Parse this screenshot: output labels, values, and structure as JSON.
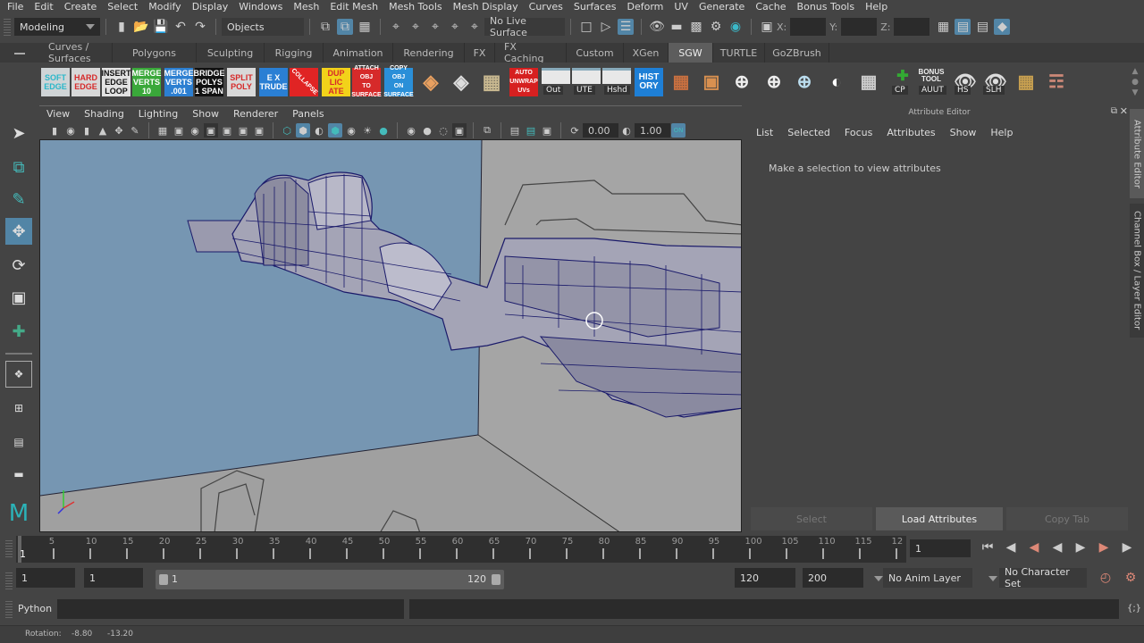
{
  "menubar": [
    "File",
    "Edit",
    "Create",
    "Select",
    "Modify",
    "Display",
    "Windows",
    "Mesh",
    "Edit Mesh",
    "Mesh Tools",
    "Mesh Display",
    "Curves",
    "Surfaces",
    "Deform",
    "UV",
    "Generate",
    "Cache",
    "Bonus Tools",
    "Help"
  ],
  "statusline": {
    "mode": "Modeling",
    "selection_mode": "Objects",
    "live_surface": "No Live Surface",
    "x_label": "X:",
    "y_label": "Y:",
    "z_label": "Z:"
  },
  "shelf_tabs": [
    "Curves / Surfaces",
    "Polygons",
    "Sculpting",
    "Rigging",
    "Animation",
    "Rendering",
    "FX",
    "FX Caching",
    "Custom",
    "XGen",
    "SGW",
    "TURTLE",
    "GoZBrush"
  ],
  "shelf_active_tab": "SGW",
  "shelf_buttons": [
    {
      "lines": [
        "SOFT",
        "EDGE"
      ],
      "bg": "#cfd4d6",
      "fg": "#2ab7c9"
    },
    {
      "lines": [
        "HARD",
        "EDGE"
      ],
      "bg": "#d8d8d8",
      "fg": "#d62a2a"
    },
    {
      "lines": [
        "INSERT",
        "EDGE",
        "LOOP"
      ],
      "bg": "#e2e2e2",
      "fg": "#111111"
    },
    {
      "lines": [
        "MERGE",
        "VERTS",
        "10"
      ],
      "bg": "#3aa83a",
      "fg": "#ffffff"
    },
    {
      "lines": [
        "MERGE",
        "VERTS",
        ".001"
      ],
      "bg": "#2c7fd1",
      "fg": "#ffffff"
    },
    {
      "lines": [
        "BRIDGE",
        "POLYS",
        "1 SPAN"
      ],
      "bg": "#111111",
      "fg": "#ffffff"
    },
    {
      "lines": [
        "SPLIT",
        "POLY"
      ],
      "bg": "#d8d8d8",
      "fg": "#d62a2a"
    },
    {
      "lines": [
        "E X",
        "TRUDE"
      ],
      "bg": "#2a7fd4",
      "fg": "#ffffff"
    },
    {
      "lines": [
        "COLLAPSE"
      ],
      "bg": "#e02424",
      "fg": "#ffffff"
    },
    {
      "lines": [
        "DUP",
        "LIC",
        "ATE"
      ],
      "bg": "#f2d21a",
      "fg": "#d62a2a"
    },
    {
      "lines": [
        "ATTACH",
        "OBJ",
        "TO",
        "SURFACE"
      ],
      "bg": "#d62a2a",
      "fg": "#ffffff"
    },
    {
      "lines": [
        "COPY",
        "OBJ",
        "ON",
        "SURFACE"
      ],
      "bg": "#2a8fd8",
      "fg": "#ffffff"
    }
  ],
  "shelf_labels": {
    "out": "Out",
    "ute": "UTE",
    "hshd": "Hshd",
    "history": [
      "HIST",
      "ORY"
    ],
    "auto_unwrap": [
      "AUTO",
      "UNWRAP",
      "UVs"
    ],
    "cp": "CP",
    "bonus": [
      "BONUS",
      "TOOL"
    ],
    "aut": "AUUT",
    "hs": "HS",
    "slh": "SLH"
  },
  "viewport": {
    "menu": [
      "View",
      "Shading",
      "Lighting",
      "Show",
      "Renderer",
      "Panels"
    ],
    "exposure": "0.00",
    "gamma": "1.00",
    "color_mgmt": "ON"
  },
  "attribute_editor": {
    "title": "Attribute Editor",
    "menu": [
      "List",
      "Selected",
      "Focus",
      "Attributes",
      "Show",
      "Help"
    ],
    "message": "Make a selection to view attributes",
    "buttons": {
      "select": "Select",
      "load": "Load Attributes",
      "copy": "Copy Tab"
    }
  },
  "side_tabs": [
    "Attribute Editor",
    "Channel Box / Layer Editor"
  ],
  "timeline": {
    "ticks": [
      5,
      10,
      15,
      20,
      25,
      30,
      35,
      40,
      45,
      50,
      55,
      60,
      65,
      70,
      75,
      80,
      85,
      90,
      95,
      100,
      105,
      110,
      115,
      "12"
    ],
    "current_frame": "1",
    "frame_field": "1"
  },
  "range": {
    "start": "1",
    "anim_start": "1",
    "range_min": "1",
    "range_max": "120",
    "end": "120",
    "anim_end": "200",
    "anim_layer": "No Anim Layer",
    "character_set": "No Character Set"
  },
  "command_line": {
    "label": "Python"
  },
  "help_line": {
    "label": "Rotation:",
    "v1": "-8.80",
    "v2": "-13.20"
  },
  "colors": {
    "accent": "#5285a6",
    "bg": "#444444",
    "field": "#2b2b2b",
    "viewport_sky": "#7696b2",
    "viewport_floor": "#a2a2a2"
  }
}
